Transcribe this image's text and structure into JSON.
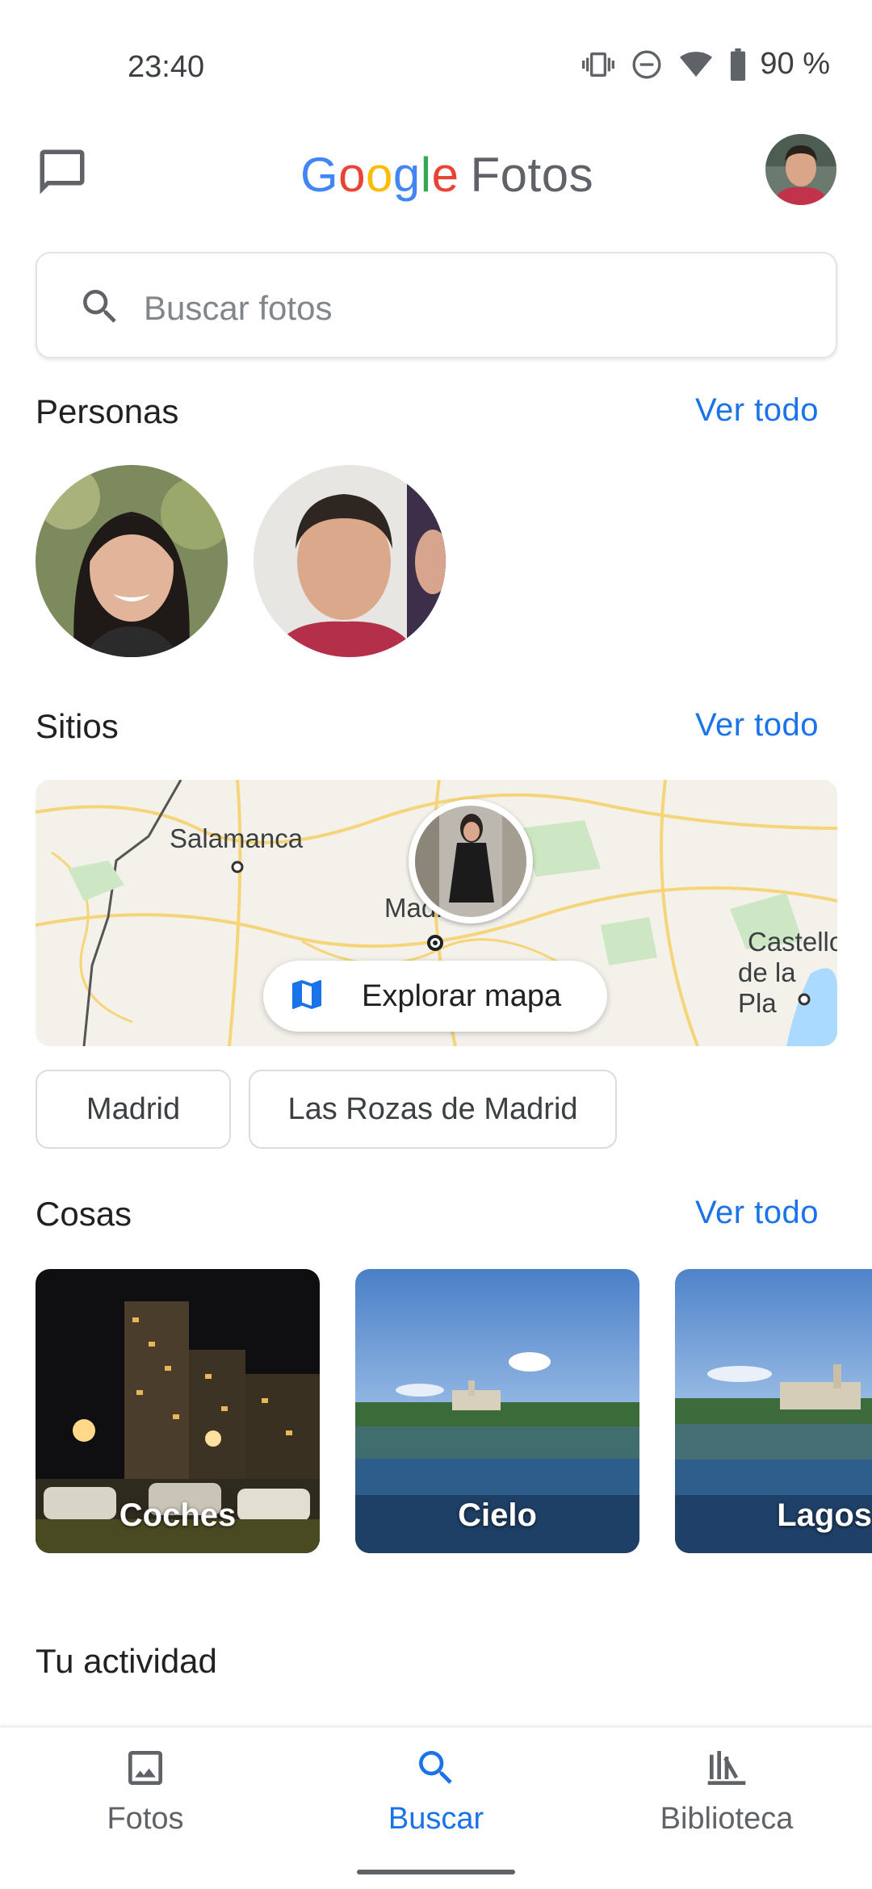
{
  "status_bar": {
    "time": "23:40",
    "battery": "90 %",
    "icons": [
      "vibrate-icon",
      "do-not-disturb-icon",
      "wifi-icon",
      "battery-icon"
    ]
  },
  "app_bar": {
    "logo_google": "Google",
    "logo_fotos": "Fotos",
    "icons": [
      "chat-icon",
      "account-avatar"
    ]
  },
  "search": {
    "placeholder": "Buscar fotos"
  },
  "personas": {
    "title": "Personas",
    "see_all": "Ver todo"
  },
  "sitios": {
    "title": "Sitios",
    "see_all": "Ver todo",
    "map_labels": [
      "Salamanca",
      "Madrid",
      "Castello",
      "de la Pla"
    ],
    "explore": "Explorar mapa",
    "chips": [
      "Madrid",
      "Las Rozas de Madrid"
    ]
  },
  "cosas": {
    "title": "Cosas",
    "see_all": "Ver todo",
    "items": [
      "Coches",
      "Cielo",
      "Lagos"
    ]
  },
  "actividad": {
    "title": "Tu actividad"
  },
  "bottom_nav": {
    "items": [
      {
        "label": "Fotos",
        "icon": "photo-icon",
        "active": false
      },
      {
        "label": "Buscar",
        "icon": "search-icon",
        "active": true
      },
      {
        "label": "Biblioteca",
        "icon": "library-icon",
        "active": false
      }
    ]
  },
  "colors": {
    "accent": "#1a73e8",
    "text": "#202124",
    "secondary": "#5f6368"
  }
}
